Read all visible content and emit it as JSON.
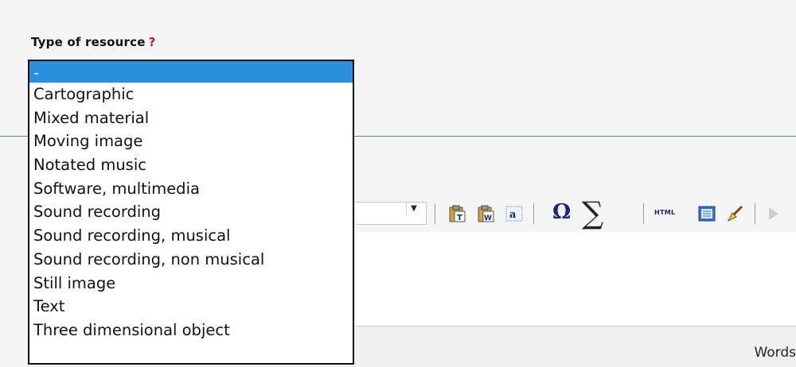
{
  "field": {
    "label": "Type of resource",
    "help_mark": "?"
  },
  "dropdown": {
    "selected_index": 0,
    "options": [
      "-",
      "Cartographic",
      "Mixed material",
      "Moving image",
      "Notated music",
      "Software, multimedia",
      "Sound recording",
      "Sound recording, musical",
      "Sound recording, non musical",
      "Still image",
      "Text",
      "Three dimensional object"
    ]
  },
  "toolbar": {
    "icons": [
      "paste-text-icon",
      "paste-word-icon",
      "spellcheck-icon",
      "special-char-omega-icon",
      "math-sigma-icon",
      "html-source-icon",
      "template-icon",
      "clean-format-icon"
    ],
    "omega_glyph": "Ω",
    "sigma_glyph": "∑",
    "html_label": "HTML"
  },
  "status_bar": {
    "words_label": "Words"
  },
  "colors": {
    "selected_bg": "#2a8fdc",
    "help_mark": "#b22222",
    "divider": "#5b88b5"
  }
}
